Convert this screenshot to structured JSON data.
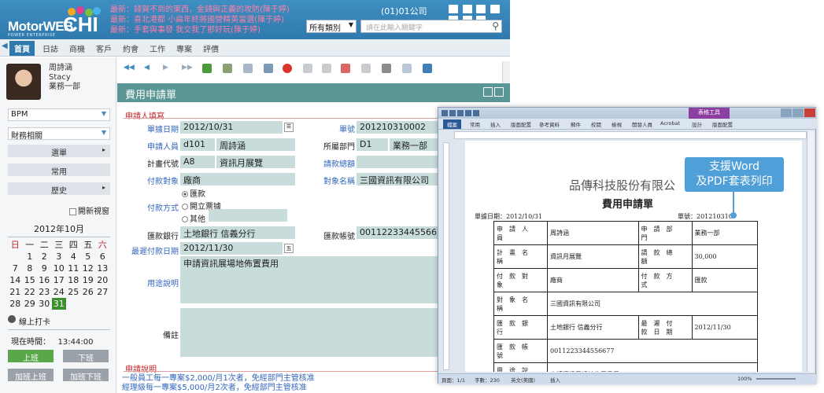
{
  "header": {
    "brand_main": "MotorWEB",
    "brand_accent": "CHI",
    "brand_sub": "POWER ENTERPRISE",
    "news": [
      "最新：錢賀不到的東西，金錢與正義的攻防(陳于婷)",
      "最新：喜北港都 小扁年終將國營精英當選(陳于婷)",
      "最新：手套與事發 我交我了那好玩(陳于婷)"
    ],
    "company": "(01)01公司",
    "category_select": "所有類別",
    "search_placeholder": "請在此輸入關鍵字"
  },
  "nav": {
    "tabs": [
      "首頁",
      "日誌",
      "商機",
      "客戶",
      "約會",
      "工作",
      "專案",
      "評價"
    ]
  },
  "user": {
    "name_cn": "周詩涵",
    "name_en": "Stacy",
    "dept": "業務一部"
  },
  "sidebar": {
    "bpm": "BPM",
    "category": "財務相關",
    "menu": [
      {
        "label": "選單",
        "arrow": "▸"
      },
      {
        "label": "常用",
        "arrow": ""
      },
      {
        "label": "歷史",
        "arrow": "▸"
      }
    ],
    "new_window": "開新視窗"
  },
  "calendar": {
    "title": "2012年10月",
    "weekdays": [
      "日",
      "一",
      "二",
      "三",
      "四",
      "五",
      "六"
    ],
    "weeks": [
      [
        "",
        "1",
        "2",
        "3",
        "4",
        "5",
        "6"
      ],
      [
        "7",
        "8",
        "9",
        "10",
        "11",
        "12",
        "13"
      ],
      [
        "14",
        "15",
        "16",
        "17",
        "18",
        "19",
        "20"
      ],
      [
        "21",
        "22",
        "23",
        "24",
        "25",
        "26",
        "27"
      ],
      [
        "28",
        "29",
        "30",
        "31",
        "",
        "",
        ""
      ]
    ],
    "today": "31"
  },
  "punch": {
    "title": "線上打卡",
    "now_label": "現在時間：",
    "now_time": "13:44:00",
    "buttons": [
      "上班",
      "下班",
      "加班上班",
      "加班下班"
    ]
  },
  "form": {
    "title": "費用申請單",
    "section1": "申請人填寫",
    "section2": "申請說明",
    "fields": {
      "date_label": "單據日期",
      "date_value": "2012/10/31",
      "no_label": "單號",
      "no_value": "201210310002",
      "applicant_label": "申請人員",
      "applicant_id": "d101",
      "applicant_name": "周詩涵",
      "dept_label": "所屬部門",
      "dept_id": "D1",
      "dept_name": "業務一部",
      "plan_label": "計畫代號",
      "plan_id": "A8",
      "plan_name": "資訊月展覽",
      "amount_label": "請款總額",
      "payee_label": "付款對象",
      "payee_value": "廠商",
      "object_label": "對象名稱",
      "object_value": "三國資訊有限公司",
      "method_label": "付款方式",
      "methods": [
        "匯款",
        "開立票據",
        "其他"
      ],
      "bank_label": "匯款銀行",
      "bank_value": "土地銀行 信義分行",
      "account_label": "匯款帳號",
      "account_value": "0011223344556677",
      "due_label": "最遲付款日期",
      "due_value": "2012/11/30",
      "purpose_label": "用途說明",
      "purpose_value": "申請資訊展場地佈置費用",
      "memo_label": "備註"
    },
    "notes": [
      "一般員工每一專案$2,000/月1次者，免經部門主管核准",
      "經理級每一專案$5,000/月2次者，免經部門主管核准"
    ]
  },
  "word": {
    "file_tab": "檔案",
    "tabs": [
      "常用",
      "插入",
      "版面配置",
      "參考資料",
      "郵件",
      "校閱",
      "檢視",
      "開發人員",
      "Acrobat",
      "設計",
      "版面配置"
    ],
    "table_tools": "表格工具",
    "company": "品傳科技股份有限公",
    "doc_title": "費用申請單",
    "date_meta": "單據日期：2012/10/31",
    "no_meta": "單號：201210310",
    "rows": [
      [
        "申請人員",
        "周詩涵",
        "申請部門",
        "業務一部"
      ],
      [
        "計畫名稱",
        "資訊月展覽",
        "請款總額",
        "30,000"
      ],
      [
        "付款對象",
        "廠商",
        "付款方式",
        "匯款"
      ],
      [
        "對象名稱",
        "三國資訊有限公司",
        "",
        ""
      ],
      [
        "匯款銀行",
        "土地銀行 信義分行",
        "最遲付款日期",
        "2012/11/30"
      ],
      [
        "匯款帳號",
        "0011223344556677",
        "",
        ""
      ],
      [
        "用途說明",
        "申請資訊展場地佈置費用",
        "",
        ""
      ]
    ],
    "status_page": "頁面：1/1",
    "status_words": "字數：230",
    "status_lang": "英文(美國)",
    "status_mode": "插入",
    "zoom": "100%"
  },
  "callout": {
    "line1": "支援Word",
    "line2": "及PDF套表列印"
  },
  "colors": {
    "brand_blue": "#2f79ad",
    "form_teal": "#5a9696",
    "field_bg": "#c9dcdc",
    "punch_green": "#5aa64b",
    "callout": "#4f9fd8"
  }
}
